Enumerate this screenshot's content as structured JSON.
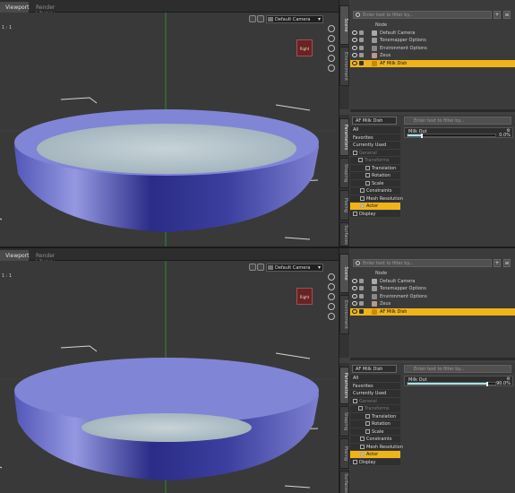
{
  "screens": [
    {
      "tabs": [
        "Viewport",
        "Render Library"
      ],
      "aspect": "1 : 1",
      "camera": "Default Camera",
      "nav_cube_label": "Right",
      "scene_filter_placeholder": "Enter text to filter by...",
      "scene_tabs": [
        "Scene",
        "Environment"
      ],
      "param_tabs": [
        "Parameters",
        "Shaping",
        "Posing",
        "Surfaces"
      ],
      "tree": [
        "Node",
        "Default Camera",
        "Tonemapper Options",
        "Environment Options",
        "Zeus",
        "AF Milk Dish"
      ],
      "actor": "AF Milk Dish",
      "param_filter_placeholder": "Enter text to filter by...",
      "param_list": [
        "All",
        "Favorites",
        "Currently Used",
        "General",
        "Transforms",
        "Translation",
        "Rotation",
        "Scale",
        "Constraints",
        "Mesh Resolution",
        "Actor",
        "Display"
      ],
      "property_name": "Milk Out",
      "property_value": "0.0%",
      "property_fill": 0.15
    },
    {
      "tabs": [
        "Viewport",
        "Render Library"
      ],
      "aspect": "1 : 1",
      "camera": "Default Camera",
      "nav_cube_label": "Right",
      "scene_filter_placeholder": "Enter text to filter by...",
      "scene_tabs": [
        "Scene",
        "Environment"
      ],
      "param_tabs": [
        "Parameters",
        "Shaping",
        "Posing",
        "Surfaces"
      ],
      "tree": [
        "Node",
        "Default Camera",
        "Tonemapper Options",
        "Environment Options",
        "Zeus",
        "AF Milk Dish"
      ],
      "actor": "AF Milk Dish",
      "param_filter_placeholder": "Enter text to filter by...",
      "param_list": [
        "All",
        "Favorites",
        "Currently Used",
        "General",
        "Transforms",
        "Translation",
        "Rotation",
        "Scale",
        "Constraints",
        "Mesh Resolution",
        "Actor",
        "Display"
      ],
      "property_name": "Milk Out",
      "property_value": "90.0%",
      "property_fill": 0.9
    }
  ]
}
